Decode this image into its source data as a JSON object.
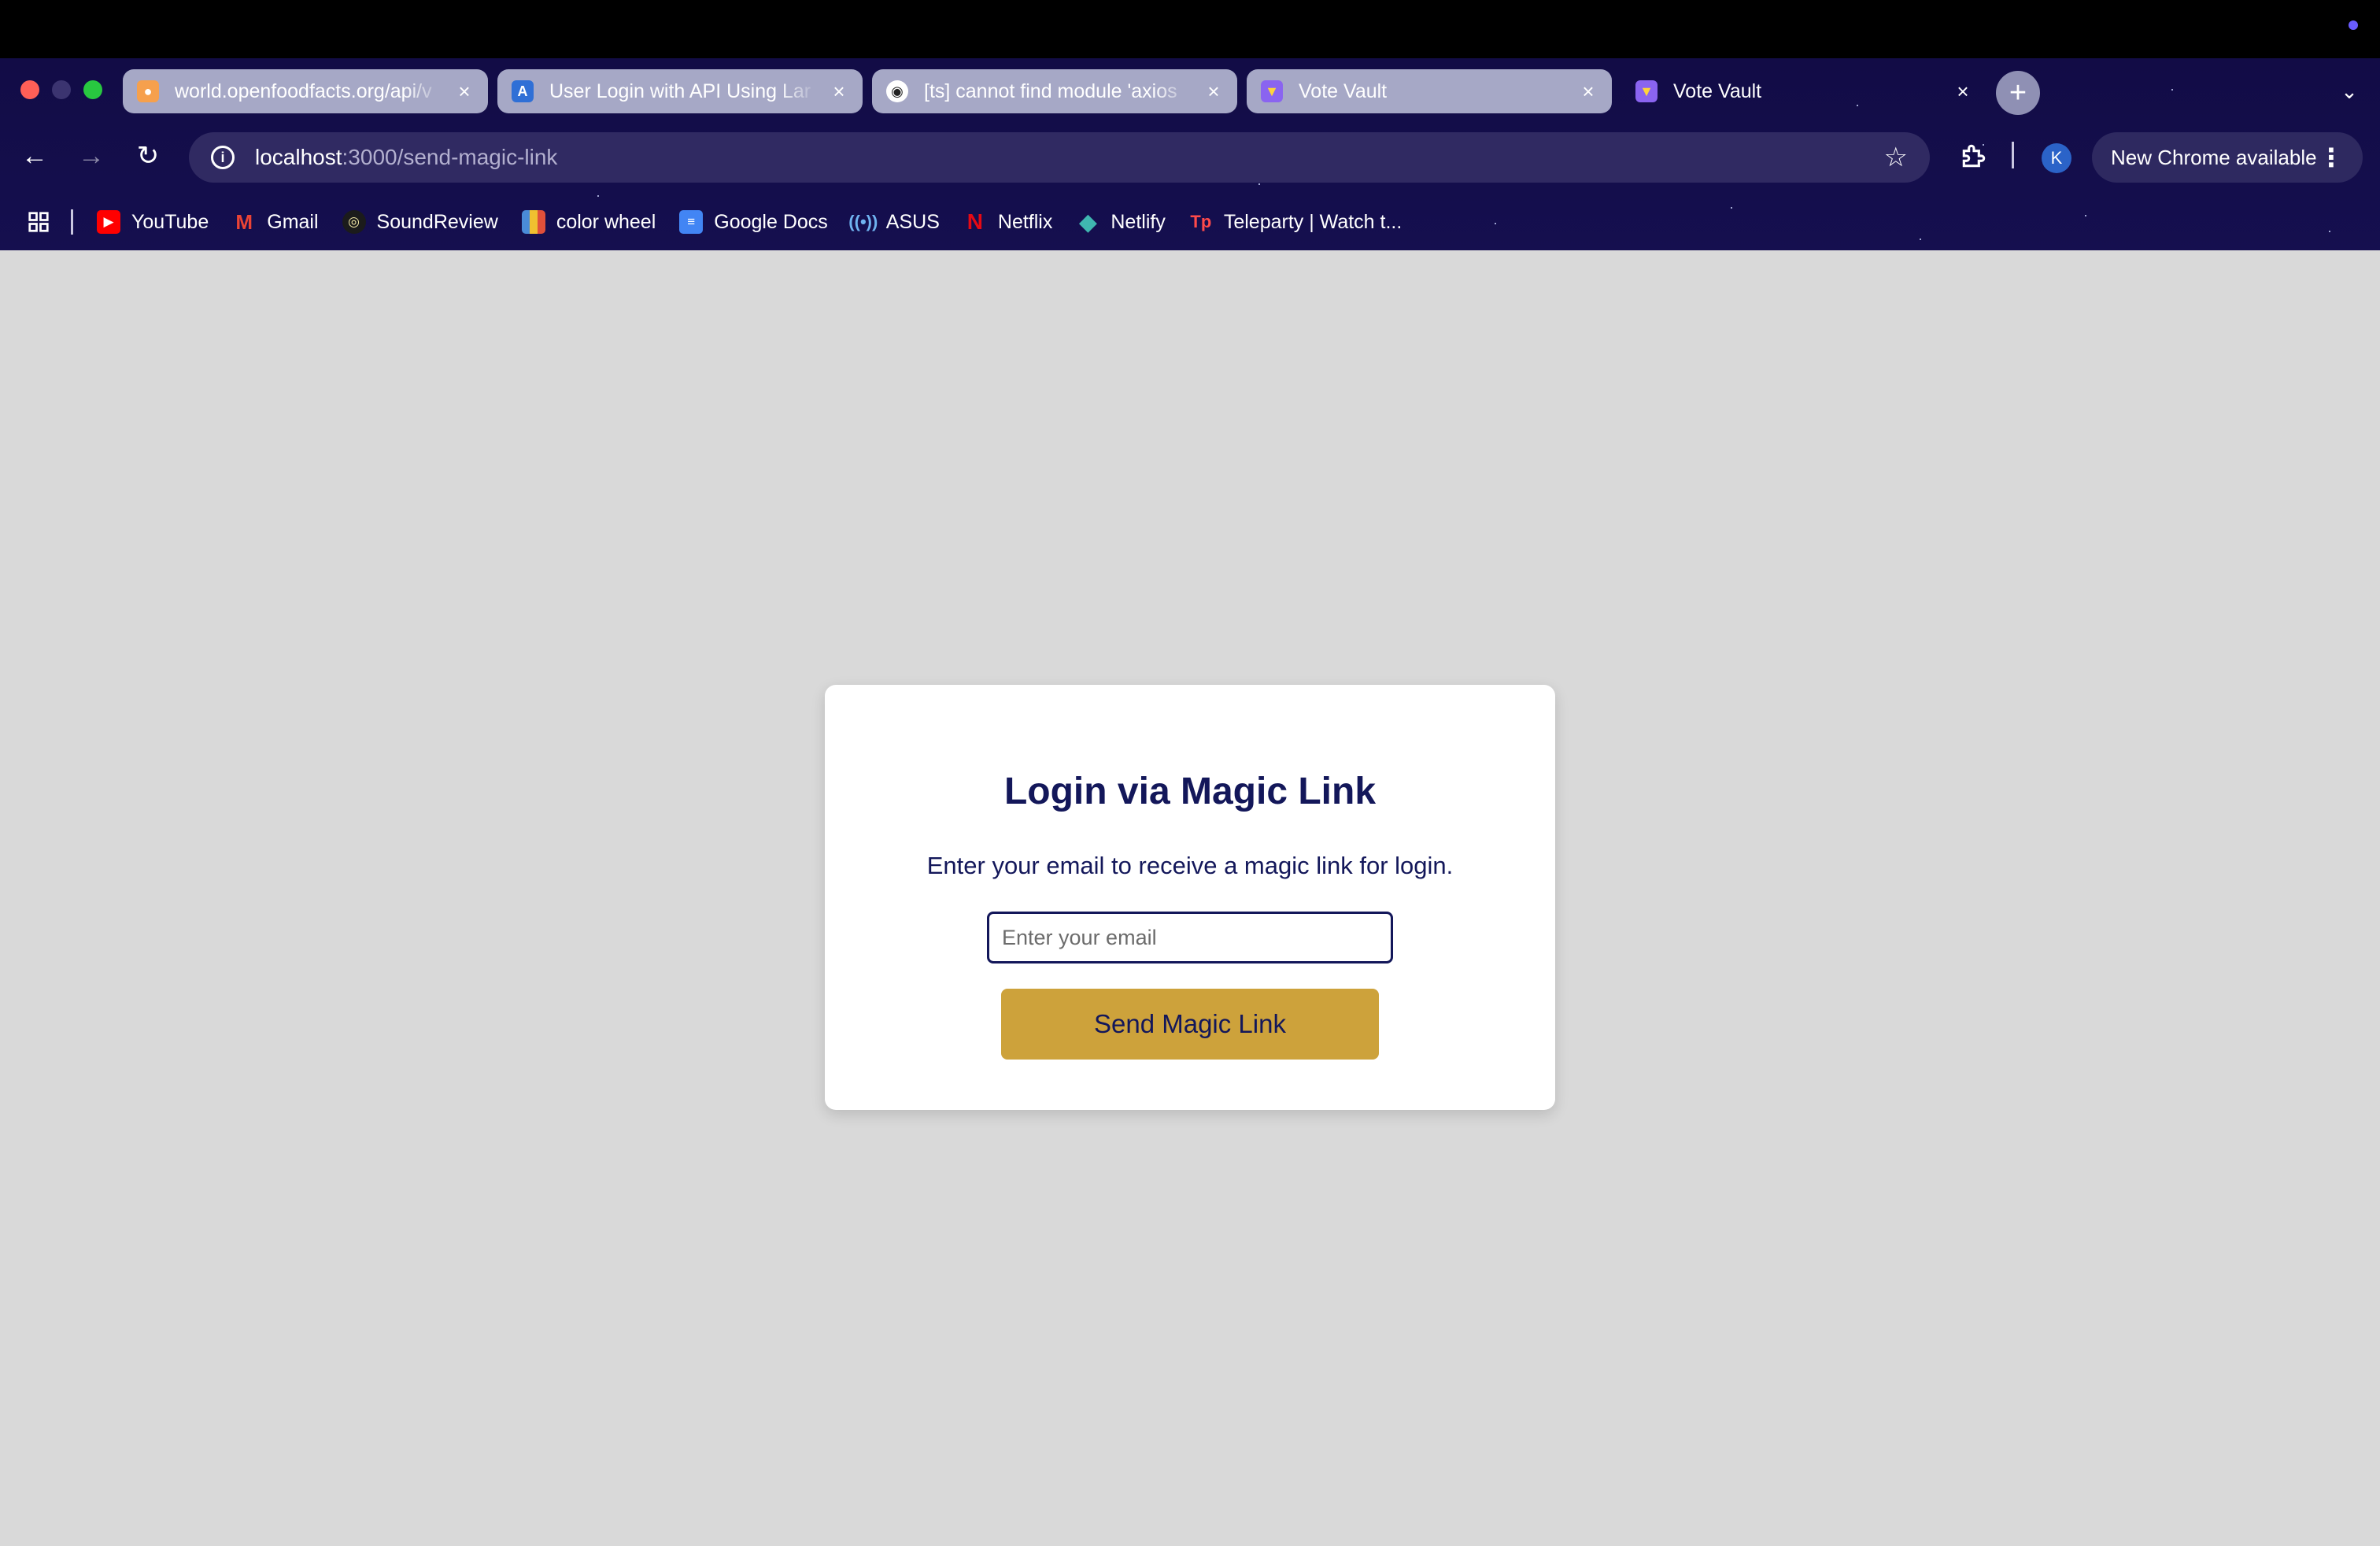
{
  "window": {
    "tabs": [
      {
        "title": "world.openfoodfacts.org/api/v",
        "favicon": "openfoodfacts-icon",
        "active": false
      },
      {
        "title": "User Login with API Using Lar",
        "favicon": "azure-icon",
        "active": false
      },
      {
        "title": "[ts] cannot find module 'axios",
        "favicon": "github-icon",
        "active": false
      },
      {
        "title": "Vote Vault",
        "favicon": "vite-icon",
        "active": false
      },
      {
        "title": "Vote Vault",
        "favicon": "vite-icon",
        "active": true
      }
    ],
    "new_tab_label": "+",
    "close_label": "×"
  },
  "toolbar": {
    "url_host": "localhost",
    "url_path": ":3000/send-magic-link",
    "profile_initial": "K",
    "update_label": "New Chrome available"
  },
  "bookmarks": [
    {
      "label": "YouTube",
      "icon": "youtube-icon"
    },
    {
      "label": "Gmail",
      "icon": "gmail-icon"
    },
    {
      "label": "SoundReview",
      "icon": "soundreview-icon"
    },
    {
      "label": "color wheel",
      "icon": "color-wheel-icon"
    },
    {
      "label": "Google Docs",
      "icon": "google-docs-icon"
    },
    {
      "label": "ASUS",
      "icon": "asus-icon"
    },
    {
      "label": "Netflix",
      "icon": "netflix-icon"
    },
    {
      "label": "Netlify",
      "icon": "netlify-icon"
    },
    {
      "label": "Teleparty | Watch t...",
      "icon": "teleparty-icon"
    }
  ],
  "page": {
    "title": "Login via Magic Link",
    "subtitle": "Enter your email to receive a magic link for login.",
    "email_placeholder": "Enter your email",
    "email_value": "",
    "submit_label": "Send Magic Link"
  },
  "colors": {
    "page_background": "#d9d9d9",
    "heading_text": "#13175a",
    "button_background": "#cda23b",
    "chrome_theme": "#150f4f"
  }
}
